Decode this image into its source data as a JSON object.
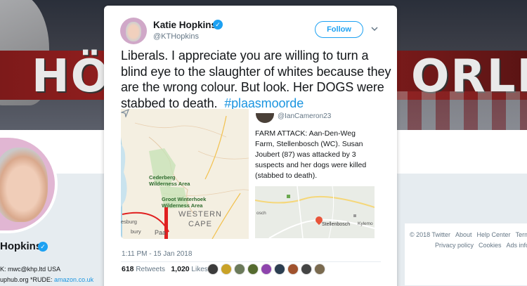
{
  "background": {
    "banner_words": [
      "HÖ",
      "ORLI"
    ],
    "profile_name": "Hopkins",
    "bio_line_1": "K: mwc@khp.ltd USA",
    "bio_line_2_prefix": "uphub.org *RUDE: ",
    "bio_link": "amazon.co.uk",
    "footer_row_1": [
      "© 2018 Twitter",
      "About",
      "Help Center",
      "Terms"
    ],
    "footer_row_2": [
      "Privacy policy",
      "Cookies",
      "Ads info"
    ]
  },
  "tweet": {
    "author_name": "Katie Hopkins",
    "author_handle": "@KTHopkins",
    "follow_label": "Follow",
    "text": "Liberals. I appreciate you are willing to turn a blind eye to the slaughter of whites because they are the wrong colour. But look. Her DOGS were stabbed to death.",
    "hashtag": "#plaasmoorde",
    "timestamp": "1:11 PM - 15 Jan 2018",
    "retweets_count": "618",
    "retweets_label": "Retweets",
    "likes_count": "1,020",
    "likes_label": "Likes",
    "liker_colors": [
      "#3b3b3b",
      "#c9a227",
      "#6b7a5a",
      "#556b2f",
      "#8e44ad",
      "#2c3e50",
      "#a0522d",
      "#444444",
      "#7a6a4f"
    ]
  },
  "quoted": {
    "handle": "@IanCameron23",
    "text": "FARM ATTACK: Aan-Den-Weg Farm, Stellenbosch (WC). Susan Joubert (87) was attacked by 3 suspects and her dogs were killed (stabbed to death).",
    "map_labels": {
      "cederberg": "Cederberg\nWilderness Area",
      "winterhoek": "Groot Winterhoek\nWilderness Area",
      "western": "WESTERN",
      "cape": "CAPE",
      "left_fragment": "esburg",
      "paarl_fragment": "Paa",
      "bottom_fragment": "bury"
    },
    "mini_map": {
      "city": "Stellenbosch",
      "label_left": "osch",
      "label_right": "Kylemo"
    }
  },
  "colors": {
    "twitter_blue": "#1da1f2",
    "link_blue": "#1b95e0",
    "text_dark": "#14171a",
    "text_gray": "#657786"
  }
}
